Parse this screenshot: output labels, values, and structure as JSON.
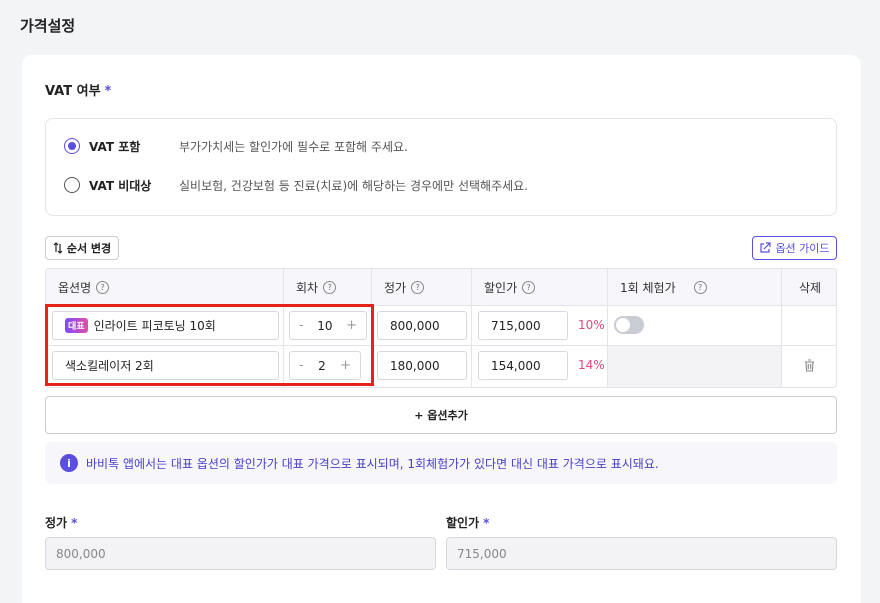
{
  "page": {
    "title": "가격설정"
  },
  "vat": {
    "label": "VAT 여부",
    "required_mark": "*",
    "options": [
      {
        "label": "VAT 포함",
        "desc": "부가가치세는 할인가에 필수로 포함해 주세요.",
        "checked": true
      },
      {
        "label": "VAT 비대상",
        "desc": "실비보험, 건강보험 등 진료(치료)에 해당하는 경우에만 선택해주세요.",
        "checked": false
      }
    ]
  },
  "toolbar": {
    "order_label": "순서 변경",
    "guide_label": "옵션 가이드"
  },
  "table": {
    "headers": {
      "name": "옵션명",
      "count": "회차",
      "price": "정가",
      "discount": "할인가",
      "trial": "1회 체험가",
      "delete": "삭제"
    },
    "rows": [
      {
        "badge": "대표",
        "name": "인라이트 피코토닝 10회",
        "count": "10",
        "price": "800,000",
        "discount": "715,000",
        "percent": "10%"
      },
      {
        "badge": "",
        "name": "색소킬레이저 2회",
        "count": "2",
        "price": "180,000",
        "discount": "154,000",
        "percent": "14%"
      }
    ],
    "stepper": {
      "minus": "-",
      "plus": "+"
    },
    "help_mark": "?"
  },
  "add_option": {
    "label": "+ 옵션추가"
  },
  "info": {
    "icon": "i",
    "text": "바비톡 앱에서는 대표 옵션의 할인가가 대표 가격으로 표시되며, 1회체험가가 있다면 대신 대표 가격으로 표시돼요."
  },
  "summary": {
    "price_label": "정가",
    "price_value": "800,000",
    "discount_label": "할인가",
    "discount_value": "715,000",
    "required_mark": "*"
  },
  "colors": {
    "accent": "#5b4fe0",
    "percent": "#e0467c",
    "highlight": "#e5231b"
  }
}
